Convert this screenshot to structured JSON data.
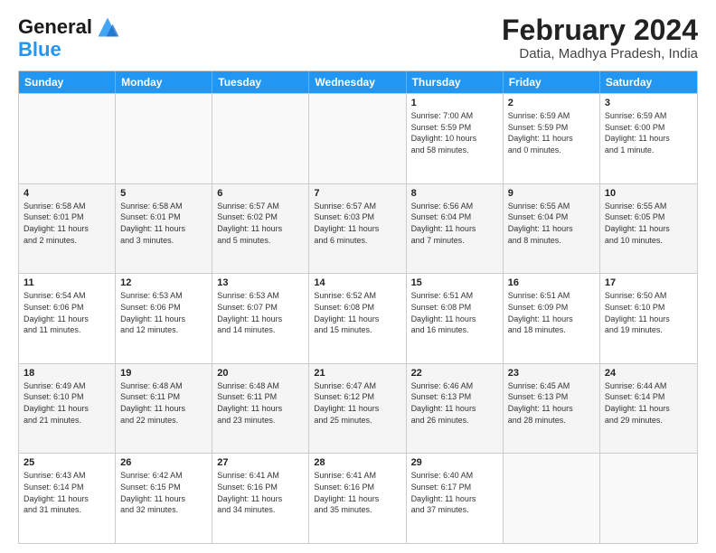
{
  "header": {
    "logo_line1": "General",
    "logo_line2": "Blue",
    "month_title": "February 2024",
    "location": "Datia, Madhya Pradesh, India"
  },
  "days_of_week": [
    "Sunday",
    "Monday",
    "Tuesday",
    "Wednesday",
    "Thursday",
    "Friday",
    "Saturday"
  ],
  "weeks": [
    [
      {
        "day": "",
        "info": ""
      },
      {
        "day": "",
        "info": ""
      },
      {
        "day": "",
        "info": ""
      },
      {
        "day": "",
        "info": ""
      },
      {
        "day": "1",
        "info": "Sunrise: 7:00 AM\nSunset: 5:59 PM\nDaylight: 10 hours\nand 58 minutes."
      },
      {
        "day": "2",
        "info": "Sunrise: 6:59 AM\nSunset: 5:59 PM\nDaylight: 11 hours\nand 0 minutes."
      },
      {
        "day": "3",
        "info": "Sunrise: 6:59 AM\nSunset: 6:00 PM\nDaylight: 11 hours\nand 1 minute."
      }
    ],
    [
      {
        "day": "4",
        "info": "Sunrise: 6:58 AM\nSunset: 6:01 PM\nDaylight: 11 hours\nand 2 minutes."
      },
      {
        "day": "5",
        "info": "Sunrise: 6:58 AM\nSunset: 6:01 PM\nDaylight: 11 hours\nand 3 minutes."
      },
      {
        "day": "6",
        "info": "Sunrise: 6:57 AM\nSunset: 6:02 PM\nDaylight: 11 hours\nand 5 minutes."
      },
      {
        "day": "7",
        "info": "Sunrise: 6:57 AM\nSunset: 6:03 PM\nDaylight: 11 hours\nand 6 minutes."
      },
      {
        "day": "8",
        "info": "Sunrise: 6:56 AM\nSunset: 6:04 PM\nDaylight: 11 hours\nand 7 minutes."
      },
      {
        "day": "9",
        "info": "Sunrise: 6:55 AM\nSunset: 6:04 PM\nDaylight: 11 hours\nand 8 minutes."
      },
      {
        "day": "10",
        "info": "Sunrise: 6:55 AM\nSunset: 6:05 PM\nDaylight: 11 hours\nand 10 minutes."
      }
    ],
    [
      {
        "day": "11",
        "info": "Sunrise: 6:54 AM\nSunset: 6:06 PM\nDaylight: 11 hours\nand 11 minutes."
      },
      {
        "day": "12",
        "info": "Sunrise: 6:53 AM\nSunset: 6:06 PM\nDaylight: 11 hours\nand 12 minutes."
      },
      {
        "day": "13",
        "info": "Sunrise: 6:53 AM\nSunset: 6:07 PM\nDaylight: 11 hours\nand 14 minutes."
      },
      {
        "day": "14",
        "info": "Sunrise: 6:52 AM\nSunset: 6:08 PM\nDaylight: 11 hours\nand 15 minutes."
      },
      {
        "day": "15",
        "info": "Sunrise: 6:51 AM\nSunset: 6:08 PM\nDaylight: 11 hours\nand 16 minutes."
      },
      {
        "day": "16",
        "info": "Sunrise: 6:51 AM\nSunset: 6:09 PM\nDaylight: 11 hours\nand 18 minutes."
      },
      {
        "day": "17",
        "info": "Sunrise: 6:50 AM\nSunset: 6:10 PM\nDaylight: 11 hours\nand 19 minutes."
      }
    ],
    [
      {
        "day": "18",
        "info": "Sunrise: 6:49 AM\nSunset: 6:10 PM\nDaylight: 11 hours\nand 21 minutes."
      },
      {
        "day": "19",
        "info": "Sunrise: 6:48 AM\nSunset: 6:11 PM\nDaylight: 11 hours\nand 22 minutes."
      },
      {
        "day": "20",
        "info": "Sunrise: 6:48 AM\nSunset: 6:11 PM\nDaylight: 11 hours\nand 23 minutes."
      },
      {
        "day": "21",
        "info": "Sunrise: 6:47 AM\nSunset: 6:12 PM\nDaylight: 11 hours\nand 25 minutes."
      },
      {
        "day": "22",
        "info": "Sunrise: 6:46 AM\nSunset: 6:13 PM\nDaylight: 11 hours\nand 26 minutes."
      },
      {
        "day": "23",
        "info": "Sunrise: 6:45 AM\nSunset: 6:13 PM\nDaylight: 11 hours\nand 28 minutes."
      },
      {
        "day": "24",
        "info": "Sunrise: 6:44 AM\nSunset: 6:14 PM\nDaylight: 11 hours\nand 29 minutes."
      }
    ],
    [
      {
        "day": "25",
        "info": "Sunrise: 6:43 AM\nSunset: 6:14 PM\nDaylight: 11 hours\nand 31 minutes."
      },
      {
        "day": "26",
        "info": "Sunrise: 6:42 AM\nSunset: 6:15 PM\nDaylight: 11 hours\nand 32 minutes."
      },
      {
        "day": "27",
        "info": "Sunrise: 6:41 AM\nSunset: 6:16 PM\nDaylight: 11 hours\nand 34 minutes."
      },
      {
        "day": "28",
        "info": "Sunrise: 6:41 AM\nSunset: 6:16 PM\nDaylight: 11 hours\nand 35 minutes."
      },
      {
        "day": "29",
        "info": "Sunrise: 6:40 AM\nSunset: 6:17 PM\nDaylight: 11 hours\nand 37 minutes."
      },
      {
        "day": "",
        "info": ""
      },
      {
        "day": "",
        "info": ""
      }
    ]
  ]
}
